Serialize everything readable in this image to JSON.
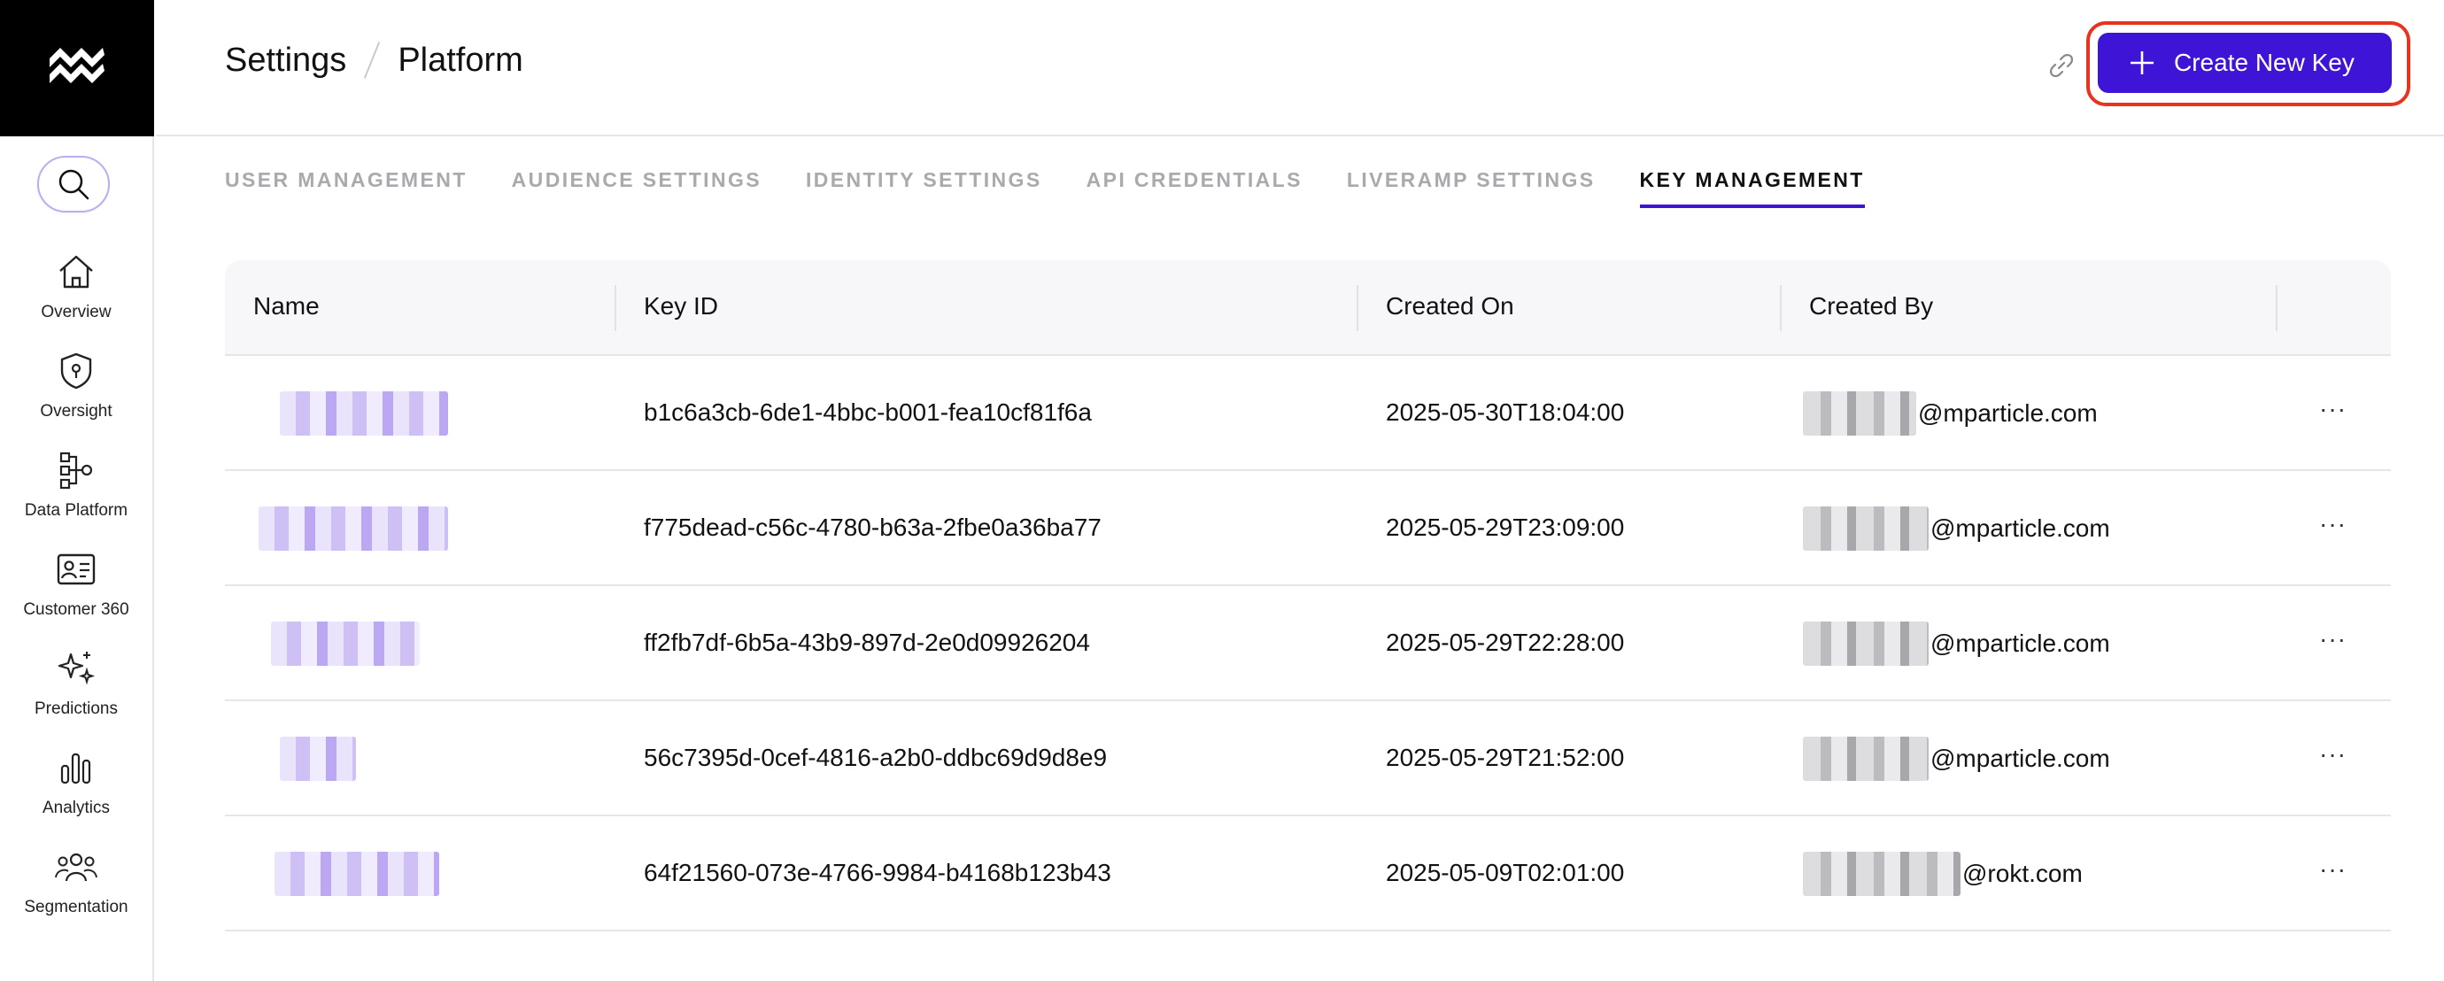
{
  "breadcrumb": {
    "root": "Settings",
    "current": "Platform"
  },
  "actions": {
    "create_label": "Create New Key"
  },
  "nav": [
    {
      "label": "Overview",
      "icon": "home-icon"
    },
    {
      "label": "Oversight",
      "icon": "shield-icon"
    },
    {
      "label": "Data Platform",
      "icon": "data-flow-icon"
    },
    {
      "label": "Customer 360",
      "icon": "id-card-icon"
    },
    {
      "label": "Predictions",
      "icon": "sparkle-icon"
    },
    {
      "label": "Analytics",
      "icon": "bar-chart-icon"
    },
    {
      "label": "Segmentation",
      "icon": "people-icon"
    }
  ],
  "tabs": [
    {
      "label": "USER MANAGEMENT",
      "active": false
    },
    {
      "label": "AUDIENCE SETTINGS",
      "active": false
    },
    {
      "label": "IDENTITY SETTINGS",
      "active": false
    },
    {
      "label": "API CREDENTIALS",
      "active": false
    },
    {
      "label": "LIVERAMP SETTINGS",
      "active": false
    },
    {
      "label": "KEY MANAGEMENT",
      "active": true
    }
  ],
  "table": {
    "columns": [
      "Name",
      "Key ID",
      "Created On",
      "Created By"
    ],
    "rows": [
      {
        "key_id": "b1c6a3cb-6de1-4bbc-b001-fea10cf81f6a",
        "created_on": "2025-05-30T18:04:00",
        "created_by_domain": "@mparticle.com",
        "more": "···"
      },
      {
        "key_id": "f775dead-c56c-4780-b63a-2fbe0a36ba77",
        "created_on": "2025-05-29T23:09:00",
        "created_by_domain": "@mparticle.com",
        "more": "···"
      },
      {
        "key_id": "ff2fb7df-6b5a-43b9-897d-2e0d09926204",
        "created_on": "2025-05-29T22:28:00",
        "created_by_domain": "@mparticle.com",
        "more": "···"
      },
      {
        "key_id": "56c7395d-0cef-4816-a2b0-ddbc69d9d8e9",
        "created_on": "2025-05-29T21:52:00",
        "created_by_domain": "@mparticle.com",
        "more": "···"
      },
      {
        "key_id": "64f21560-073e-4766-9984-b4168b123b43",
        "created_on": "2025-05-09T02:01:00",
        "created_by_domain": "@rokt.com",
        "more": "···"
      }
    ]
  },
  "colors": {
    "accent": "#3e14d6",
    "focus_ring": "#e8331f",
    "logo_bg": "#000000"
  }
}
